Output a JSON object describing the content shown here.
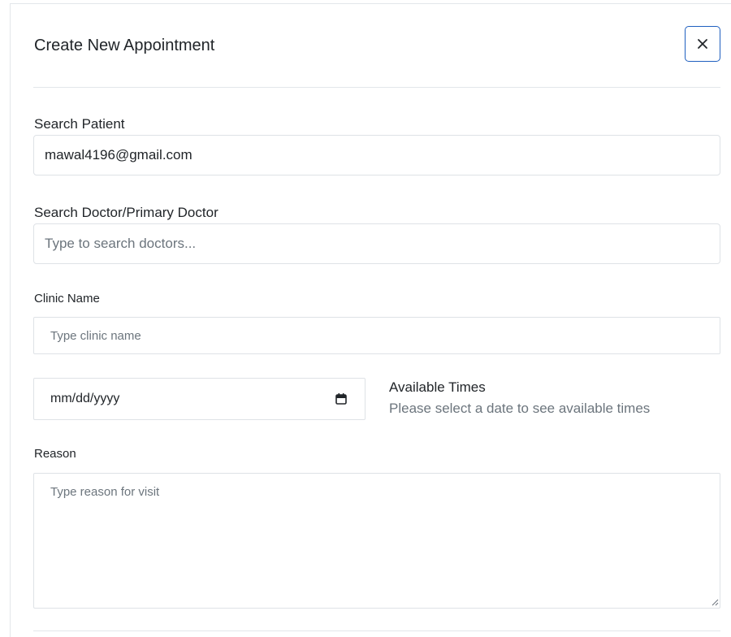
{
  "modal": {
    "title": "Create New Appointment",
    "close_icon": "close-icon"
  },
  "patient": {
    "label": "Search Patient",
    "value": "mawal4196@gmail.com"
  },
  "doctor": {
    "label": "Search Doctor/Primary Doctor",
    "placeholder": "Type to search doctors..."
  },
  "clinic": {
    "label": "Clinic Name",
    "placeholder": "Type clinic name"
  },
  "date": {
    "value": "mm/dd/yyyy",
    "icon": "calendar-icon"
  },
  "available_times": {
    "title": "Available Times",
    "hint": "Please select a date to see available times"
  },
  "reason": {
    "label": "Reason",
    "placeholder": "Type reason for visit"
  },
  "colors": {
    "accent": "#1f5fbf",
    "border": "#dee2e6",
    "muted_text": "#6c757d"
  }
}
